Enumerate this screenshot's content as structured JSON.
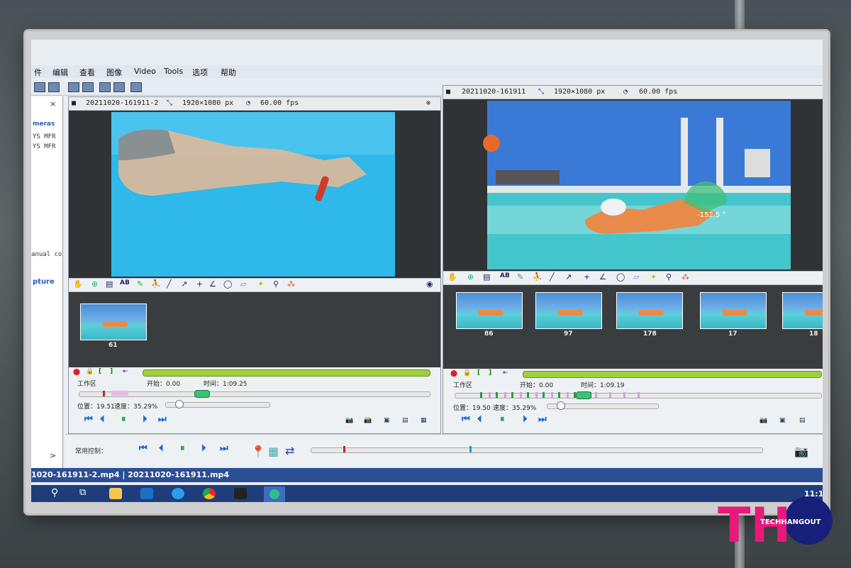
{
  "menu": {
    "items": [
      "件",
      "编辑",
      "查看",
      "图像",
      "Video",
      "Tools",
      "选项",
      "帮助"
    ]
  },
  "sidebar": {
    "close_label": "×",
    "header": "meras",
    "rows": [
      "YS MFR",
      "YS MFR"
    ],
    "manual": "anual co",
    "capture": "pture",
    "scroll_arrow": ">"
  },
  "left_panel": {
    "filename": "20211020-161911-2",
    "resolution": "1920×1080 px",
    "fps": "60.00 fps",
    "thumbnails": [
      "61"
    ],
    "workspace_label": "工作区",
    "start": "开始：0.00",
    "time": "时间：1:09.25",
    "position": "位置：19.51",
    "speed": "速度：35.29%",
    "progress_fraction": 0.35
  },
  "right_panel": {
    "filename": "20211020-161911",
    "resolution": "1920×1080 px",
    "fps": "60.00 fps",
    "angle": "-152.5 °",
    "thumbnails": [
      "86",
      "97",
      "178",
      "17",
      "18"
    ],
    "workspace_label": "工作区",
    "start": "开始：0.00",
    "time": "时间：1:09.19",
    "position": "位置：19.50",
    "speed": "速度：35.29%",
    "progress_fraction": 0.35
  },
  "common_controls": {
    "label": "常用控制："
  },
  "status": {
    "files": "1020-161911-2.mp4 | 20211020-161911.mp4"
  },
  "taskbar": {
    "clock": "11:1"
  },
  "watermark": {
    "th": "TH",
    "brand": "TECHHANGOUT"
  },
  "colors": {
    "accent_green": "#9fd13e",
    "watermark_pink": "#e8197a",
    "watermark_navy": "#16207a"
  }
}
